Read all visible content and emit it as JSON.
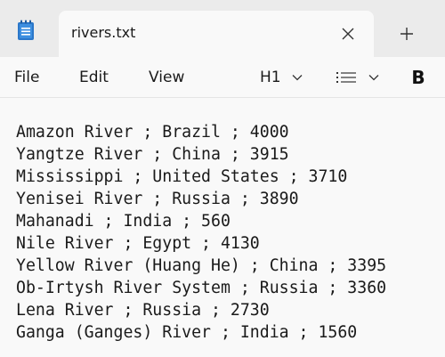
{
  "window": {
    "tab_title": "rivers.txt",
    "icons": {
      "app": "notepad-icon",
      "close": "close-icon",
      "new_tab": "plus-icon"
    }
  },
  "menu": {
    "file": "File",
    "edit": "Edit",
    "view": "View",
    "heading_value": "H1",
    "bold": "B",
    "icons": {
      "heading_dropdown": "chevron-down-icon",
      "list": "list-icon",
      "list_dropdown": "chevron-down-icon"
    }
  },
  "editor": {
    "lines": [
      "Amazon River ; Brazil ; 4000",
      "Yangtze River ; China ; 3915",
      "Mississippi ; United States ; 3710",
      "Yenisei River ; Russia ; 3890",
      "Mahanadi ; India ; 560",
      "Nile River ; Egypt ; 4130",
      "Yellow River (Huang He) ; China ; 3395",
      "Ob-Irtysh River System ; Russia ; 3360",
      "Lena River ; Russia ; 2730",
      "Ganga (Ganges) River ; India ; 1560"
    ]
  },
  "colors": {
    "titlebar": "#ebebeb",
    "surface": "#f9f9f9",
    "text": "#1a1a1a",
    "icon_blue": "#2b77c9"
  }
}
